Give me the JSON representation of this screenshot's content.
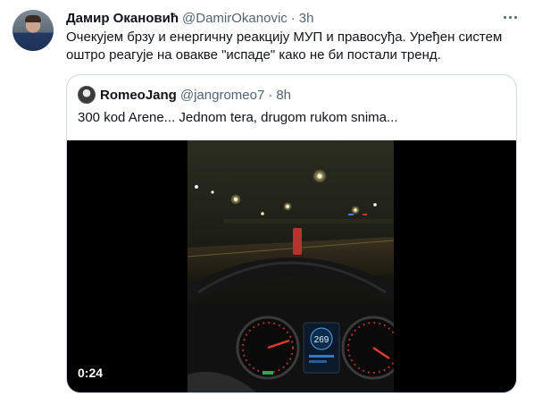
{
  "tweet": {
    "author_name": "Дамир Окановић",
    "author_handle": "@DamirOkanovic",
    "separator": "·",
    "time": "3h",
    "text": "Очекујем брзу и енергичну реакцију МУП и правосуђа. Уређен систем оштро реагује на овакве \"испаде\" како не би постали тренд.",
    "more_icon": "more-horizontal-icon"
  },
  "quoted_tweet": {
    "author_name": "RomeoJang",
    "author_handle": "@jangromeo7",
    "separator": "·",
    "time": "8h",
    "text": "300 kod Arene... Jednom tera, drugom rukom snima..."
  },
  "video": {
    "duration": "0:24",
    "speedometer_reading": "269",
    "accent_red": "#c0392b"
  }
}
